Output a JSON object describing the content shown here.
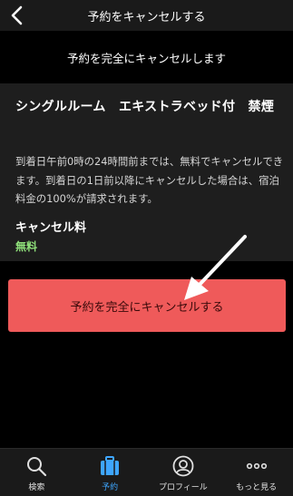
{
  "header": {
    "title": "予約をキャンセルする"
  },
  "subheader": {
    "text": "予約を完全にキャンセルします"
  },
  "room": {
    "name": "シングルルーム　エキストラベッド付　禁煙"
  },
  "policy": {
    "text": "到着日午前0時の24時間前までは、無料でキャンセルできます。到着日の1日前以降にキャンセルした場合は、宿泊料金の100%が請求されます。"
  },
  "fee": {
    "label": "キャンセル料",
    "value": "無料"
  },
  "action": {
    "cancel_label": "予約を完全にキャンセルする"
  },
  "tabs": [
    {
      "label": "検索",
      "icon": "search-icon",
      "active": false
    },
    {
      "label": "予約",
      "icon": "suitcase-icon",
      "active": true
    },
    {
      "label": "プロフィール",
      "icon": "profile-icon",
      "active": false
    },
    {
      "label": "もっと見る",
      "icon": "more-icon",
      "active": false
    }
  ],
  "colors": {
    "accent": "#3ea6ff",
    "danger": "#ef5a5a",
    "free": "#8fe07a"
  }
}
